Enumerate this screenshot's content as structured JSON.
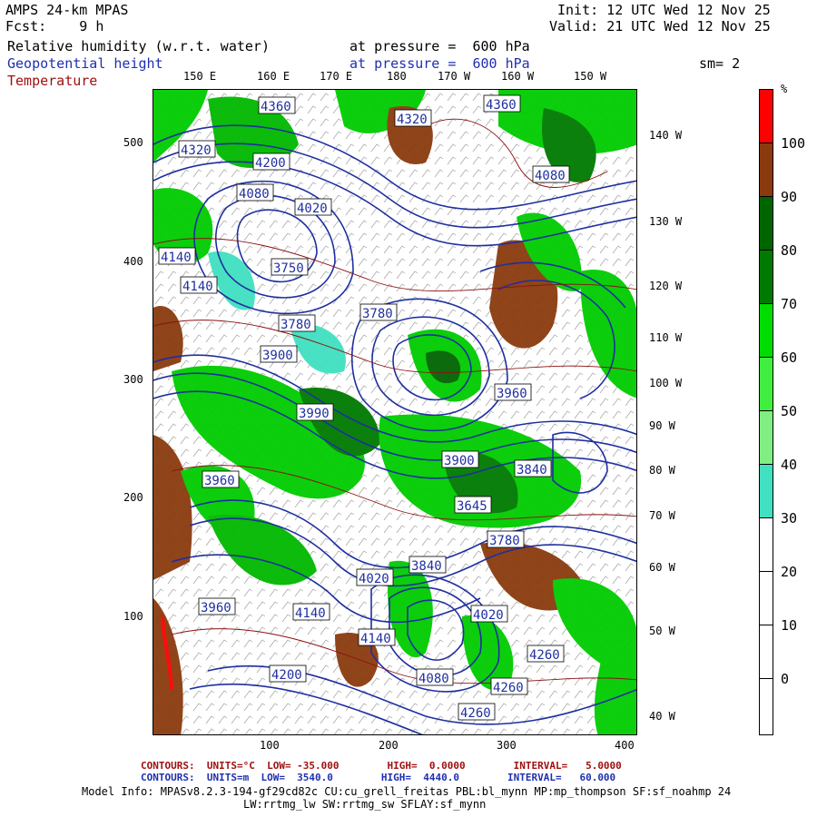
{
  "header": {
    "model": "AMPS 24-km MPAS",
    "fcst": "Fcst:    9 h",
    "init": "Init: 12 UTC Wed 12 Nov 25",
    "valid": "Valid: 21 UTC Wed 12 Nov 25",
    "fields": [
      {
        "name": "Relative humidity (w.r.t. water)",
        "level": "at pressure =  600 hPa"
      },
      {
        "name": "Geopotential height",
        "level": "at pressure =  600 hPa"
      },
      {
        "name": "Temperature",
        "level": "at pressure =  600 hPa"
      }
    ],
    "smoothing": "sm= 2"
  },
  "axes": {
    "top_lon": [
      "150 E",
      "160 E",
      "170 E",
      "180",
      "170 W",
      "160 W",
      "150 W"
    ],
    "right_lon": [
      "140 W",
      "130 W",
      "120 W",
      "110 W",
      "100 W",
      "90 W",
      "80 W",
      "70 W",
      "60 W",
      "50 W",
      "40 W"
    ],
    "left_y": [
      "500",
      "400",
      "300",
      "200",
      "100"
    ],
    "bottom_x": [
      "100",
      "200",
      "300",
      "400"
    ]
  },
  "colorbar": {
    "unit": "%",
    "labels": [
      "100",
      "90",
      "80",
      "70",
      "60",
      "50",
      "40",
      "30",
      "20",
      "10",
      "0"
    ],
    "colors": [
      "#ff0000",
      "#8b3a0e",
      "#006400",
      "#007a00",
      "#00dd00",
      "#40ee40",
      "#80ee80",
      "#40e0c0",
      "#ffffff",
      "#ffffff",
      "#ffffff",
      "#ffffff"
    ]
  },
  "map": {
    "height_labels": [
      "4360",
      "4320",
      "4360",
      "4320",
      "4200",
      "4080",
      "4020",
      "4080",
      "4140",
      "4140",
      "3750",
      "3780",
      "3780",
      "3900",
      "3990",
      "3960",
      "3900",
      "3840",
      "3960",
      "4140",
      "4020",
      "4140",
      "4020",
      "4260",
      "4200",
      "4260",
      "4080",
      "3960",
      "4020",
      "4140",
      "3840",
      "3780",
      "3645",
      "3780",
      "3960",
      "4260"
    ],
    "colors": {
      "ocean": "#ffffff",
      "moist": "#00cc00",
      "wet": "#006400",
      "sat": "#8b3a0e",
      "height": "#1f2f9f",
      "temp": "#8b1010"
    }
  },
  "footer": {
    "line1_red": "CONTOURS:  UNITS=°C  LOW= -35.000        HIGH=  0.0000        INTERVAL=   5.0000",
    "line2_blue": "CONTOURS:  UNITS=m  LOW=  3540.0        HIGH=  4440.0        INTERVAL=   60.000",
    "model_info": "Model Info: MPASv8.2.3-194-gf29cd82c CU:cu_grell_freitas PBL:bl_mynn MP:mp_thompson SF:sf_noahmp 24",
    "model_info2": "LW:rrtmg_lw SW:rrtmg_sw SFLAY:sf_mynn"
  }
}
